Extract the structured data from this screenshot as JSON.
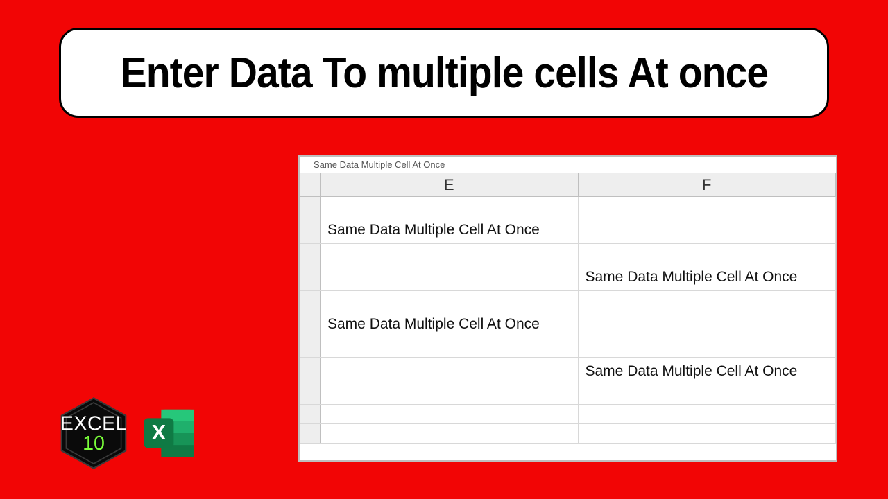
{
  "title": "Enter Data To multiple cells At once",
  "formula_bar_text": "Same Data Multiple Cell At Once",
  "columns": [
    "E",
    "F"
  ],
  "rows": [
    {
      "E": "",
      "F": ""
    },
    {
      "E": "Same Data Multiple Cell At Once",
      "F": ""
    },
    {
      "E": "",
      "F": ""
    },
    {
      "E": "",
      "F": "Same Data Multiple Cell At Once"
    },
    {
      "E": "",
      "F": ""
    },
    {
      "E": "Same Data Multiple Cell At Once",
      "F": ""
    },
    {
      "E": "",
      "F": ""
    },
    {
      "E": "",
      "F": "Same Data Multiple Cell At Once"
    },
    {
      "E": "",
      "F": ""
    },
    {
      "E": "",
      "F": ""
    },
    {
      "E": "",
      "F": ""
    }
  ],
  "logo": {
    "line1": "EXCEL",
    "line2": "10",
    "icon_letter": "X"
  }
}
